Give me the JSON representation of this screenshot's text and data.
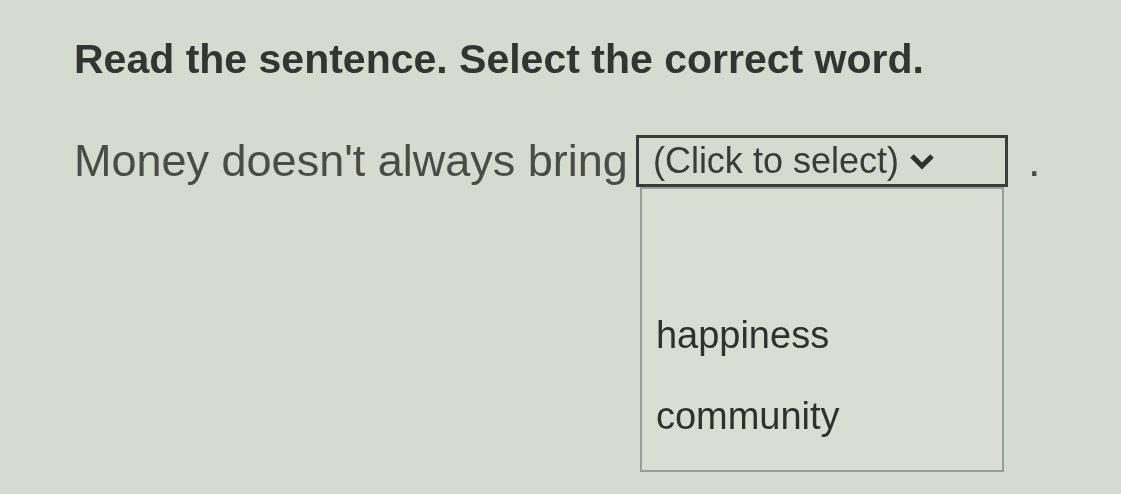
{
  "instruction": "Read the sentence. Select the correct word.",
  "sentence": {
    "before": "Money doesn't always bring",
    "after": "."
  },
  "dropdown": {
    "value": "(Click to select)",
    "expanded": true,
    "options": [
      {
        "label": "happiness",
        "selected": false
      },
      {
        "label": "community",
        "selected": false
      }
    ]
  }
}
